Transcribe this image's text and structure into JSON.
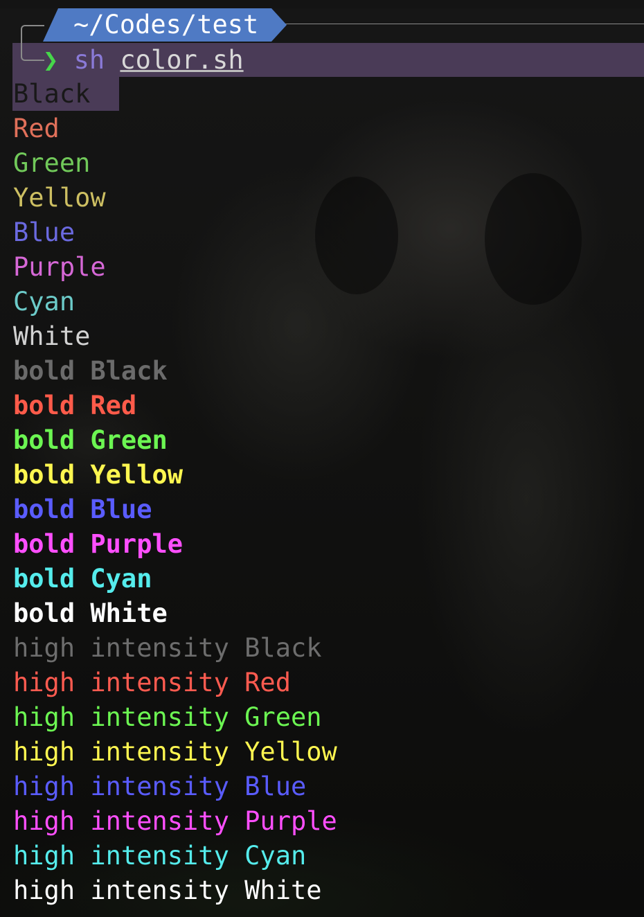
{
  "prompt": {
    "path": "~/Codes/test",
    "chevron": "❯",
    "command": "sh",
    "argument": "color.sh"
  },
  "colors": {
    "black": "#181818",
    "red": "#e0705a",
    "green": "#71c95a",
    "yellow": "#cdbf62",
    "blue": "#6b6ae0",
    "purple": "#d668d6",
    "cyan": "#6ccbc9",
    "white": "#d2d2d2",
    "bold_black": "#6b6b6b",
    "bold_red": "#ff5b4a",
    "bold_green": "#6cf652",
    "bold_yellow": "#fef650",
    "bold_blue": "#5a5cff",
    "bold_purple": "#ff4fff",
    "bold_cyan": "#55ecec",
    "bold_white": "#ffffff",
    "hi_black": "#6d6d6d",
    "hi_red": "#ff5b50",
    "hi_green": "#6cf652",
    "hi_yellow": "#fef650",
    "hi_blue": "#5a5cff",
    "hi_purple": "#ff4fff",
    "hi_cyan": "#55ecec",
    "hi_white": "#ffffff"
  },
  "output": {
    "regular": [
      "Black",
      "Red",
      "Green",
      "Yellow",
      "Blue",
      "Purple",
      "Cyan",
      "White"
    ],
    "bold": [
      "bold Black",
      "bold Red",
      "bold Green",
      "bold Yellow",
      "bold Blue",
      "bold Purple",
      "bold Cyan",
      "bold White"
    ],
    "high_intensity": [
      "high intensity Black",
      "high intensity Red",
      "high intensity Green",
      "high intensity Yellow",
      "high intensity Blue",
      "high intensity Purple",
      "high intensity Cyan",
      "high intensity White"
    ]
  }
}
